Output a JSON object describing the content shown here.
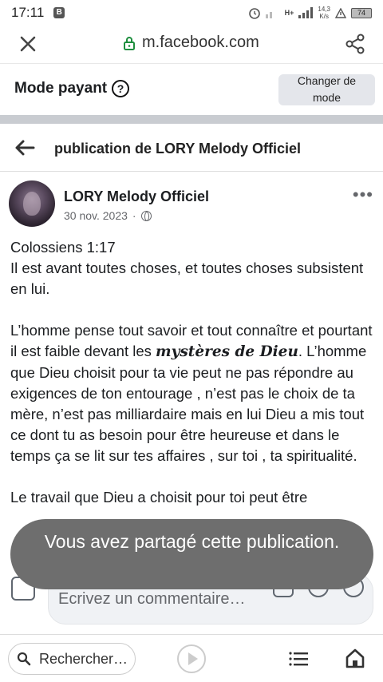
{
  "status_bar": {
    "time": "17:11",
    "sim_badge": "B",
    "network": "H+",
    "speed_top": "14,3",
    "speed_bottom": "K/s",
    "battery": "74"
  },
  "url_bar": {
    "domain": "m.facebook.com",
    "icons": [
      "close-icon",
      "lock-icon",
      "share-icon"
    ]
  },
  "mode_bar": {
    "title": "Mode payant",
    "help_glyph": "?",
    "change_line1": "Changer de",
    "change_line2": "mode"
  },
  "pub_header": {
    "title": "publication de LORY Melody Officiel"
  },
  "post": {
    "author": "LORY Melody Officiel",
    "date": "30 nov. 2023",
    "dot": "·",
    "more": "•••",
    "para1_line1": "Colossiens 1:17",
    "para1_rest": "Il est avant toutes choses, et toutes choses subsistent en lui.",
    "para2_before": "L’homme pense tout savoir et tout connaître et pourtant il est faible devant les ",
    "para2_emph": "mystères de Dieu",
    "para2_after": ". L’homme que Dieu choisit pour ta vie peut ne pas répondre au exigences de ton entourage , n’est pas le choix de ta mère, n’est pas milliardaire mais en lui Dieu a mis tout ce dont tu as besoin pour être heureuse et dans le temps ça se lit sur tes affaires , sur toi , ta spiritualité.",
    "para3": "Le travail que Dieu a choisit pour toi peut être"
  },
  "toast": {
    "text": "Vous avez partagé cette publication."
  },
  "comment_bar": {
    "placeholder": "Ecrivez un commentaire…"
  },
  "bottom_nav": {
    "search_label": "Rechercher…"
  }
}
